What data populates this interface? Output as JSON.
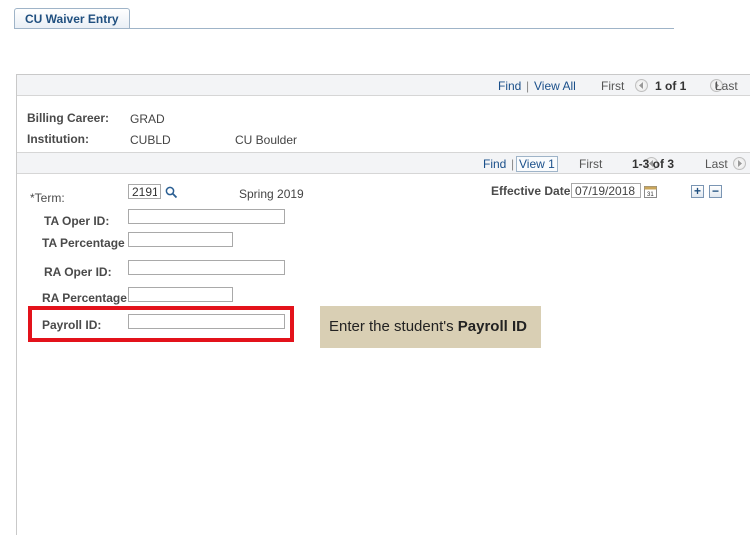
{
  "tab": {
    "label": "CU Waiver Entry"
  },
  "header_nav": {
    "find": "Find",
    "view_all": "View All",
    "first": "First",
    "page": "1 of 1",
    "last": "Last"
  },
  "billing": {
    "career_label": "Billing Career:",
    "career_value": "GRAD",
    "institution_label": "Institution:",
    "institution_code": "CUBLD",
    "institution_name": "CU Boulder"
  },
  "row_nav": {
    "find": "Find",
    "view": "View 1",
    "first": "First",
    "page": "1-3 of 3",
    "last": "Last"
  },
  "form": {
    "term_label": "*Term:",
    "term_value": "2191",
    "term_desc": "Spring 2019",
    "effective_date_label": "Effective Date",
    "effective_date_value": "07/19/2018",
    "ta_oper_label": "TA Oper ID:",
    "ta_oper_value": "",
    "ta_pct_label": "TA Percentage",
    "ta_pct_value": "",
    "ra_oper_label": "RA Oper ID:",
    "ra_oper_value": "",
    "ra_pct_label": "RA Percentage",
    "ra_pct_value": "",
    "payroll_label": "Payroll ID:",
    "payroll_value": ""
  },
  "callout": {
    "text_prefix": "Enter the student's ",
    "text_bold": "Payroll ID"
  },
  "icons": {
    "lookup": "search-icon",
    "calendar": "calendar-icon",
    "add": "plus-icon",
    "remove": "minus-icon",
    "prev": "arrow-left-icon",
    "next": "arrow-right-icon"
  },
  "colors": {
    "highlight_border": "#e3121b",
    "callout_bg": "#d9cfb4",
    "link": "#1a4f8a"
  }
}
